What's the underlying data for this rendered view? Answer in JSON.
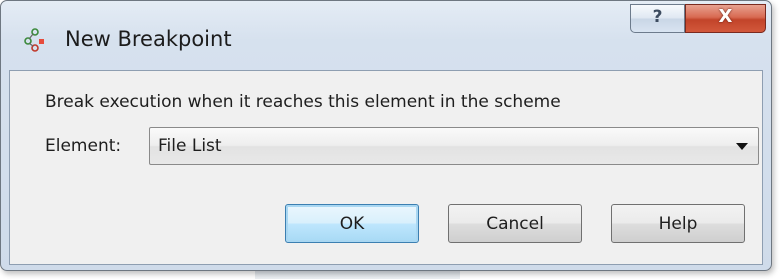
{
  "window": {
    "title": "New Breakpoint",
    "title_icon": "breakpoint-scheme-icon",
    "help_glyph": "?",
    "close_glyph": "X"
  },
  "dialog": {
    "instruction": "Break execution when it reaches this element in the scheme",
    "element_label": "Element:",
    "element_value": "File List"
  },
  "buttons": {
    "ok": "OK",
    "cancel": "Cancel",
    "help": "Help"
  },
  "colors": {
    "accent_default_button": "#3c7fb1",
    "close_button": "#c2442a"
  }
}
